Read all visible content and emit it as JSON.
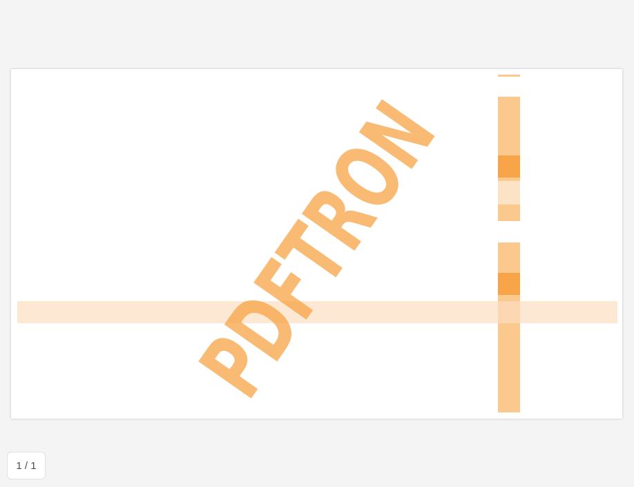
{
  "document": {
    "watermark_logo_text": "PDFTRON",
    "accent_color": "#f7a13d"
  },
  "page_indicator": {
    "current_page": 1,
    "total_pages": 1,
    "label": "1 / 1"
  }
}
